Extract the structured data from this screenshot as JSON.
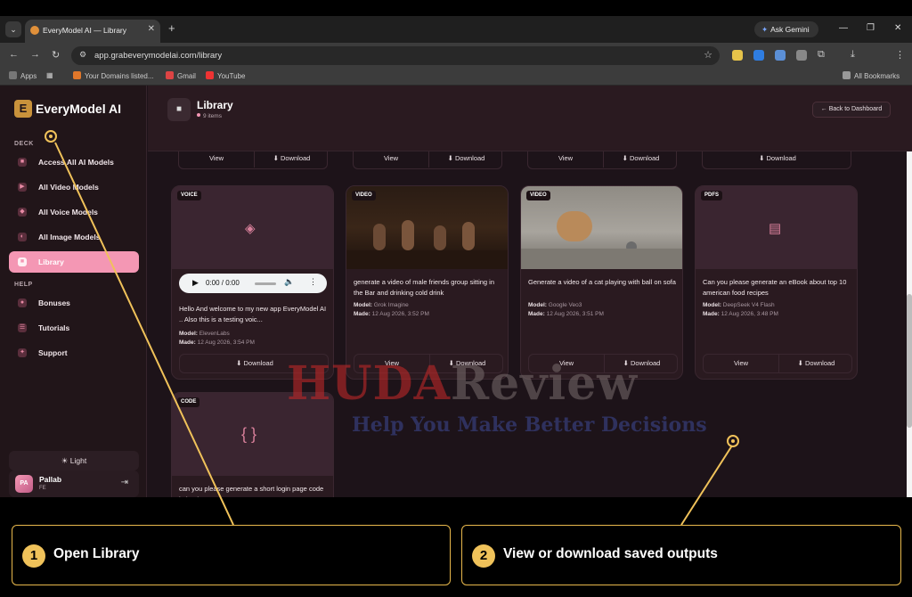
{
  "browser": {
    "tab_title": "EveryModel AI — Library",
    "ask_gemini": "Ask Gemini",
    "url": "app.grabeverymodelai.com/library",
    "bookmarks": [
      "Apps",
      "Your Domains listed...",
      "Gmail",
      "YouTube"
    ],
    "all_bookmarks": "All Bookmarks"
  },
  "sidebar": {
    "logo": "EveryModel AI",
    "logo_mark": "E",
    "section_deck": "DECK",
    "deck_items": [
      {
        "label": "Access All AI Models",
        "icon": "grid-icon"
      },
      {
        "label": "All Video Models",
        "icon": "play-icon"
      },
      {
        "label": "All Voice Models",
        "icon": "voice-icon"
      },
      {
        "label": "All Image Models",
        "icon": "image-icon"
      },
      {
        "label": "Library",
        "icon": "library-icon"
      }
    ],
    "section_help": "HELP",
    "help_items": [
      {
        "label": "Bonuses",
        "icon": "bonus-icon"
      },
      {
        "label": "Tutorials",
        "icon": "tutorial-icon"
      },
      {
        "label": "Support",
        "icon": "support-icon"
      }
    ],
    "light_toggle": "Light",
    "user": {
      "initials": "PA",
      "name": "Pallab",
      "role": "FE"
    }
  },
  "header": {
    "title": "Library",
    "count": "9 items",
    "back_button": "← Back to Dashboard"
  },
  "labels": {
    "view": "View",
    "download": "⬇ Download",
    "model": "Model:",
    "made": "Made:"
  },
  "cards": [
    {
      "type": "VOICE",
      "desc": "Hello And welcome to my new app EveryModel AI .. Also this is a testing voic...",
      "model": "ElevenLabs",
      "made": "12 Aug 2026, 3:54 PM",
      "player_time": "0:00 / 0:00"
    },
    {
      "type": "VIDEO",
      "desc": "generate a video of male friends group sitting in the Bar and drinking cold drink",
      "model": "Grok Imagine",
      "made": "12 Aug 2026, 3:52 PM"
    },
    {
      "type": "VIDEO",
      "desc": "Generate a video of a cat playing with ball on sofa",
      "model": "Google Veo3",
      "made": "12 Aug 2026, 3:51 PM"
    },
    {
      "type": "PDFS",
      "desc": "Can you please generate an eBook about top 10 american food recipes",
      "model": "DeepSeek V4 Flash",
      "made": "12 Aug 2026, 3:48 PM"
    },
    {
      "type": "CODE",
      "desc": "can you please generate a short login page code in html",
      "icon_glyph": "{ }"
    }
  ],
  "watermark": {
    "line1_a": "HUDA",
    "line1_b": "Review",
    "line2": "Help You Make Better Decisions"
  },
  "callouts": [
    {
      "number": "1",
      "text": "Open Library"
    },
    {
      "number": "2",
      "text": "View or download saved outputs"
    }
  ],
  "colors": {
    "accent": "#f497b4",
    "callout": "#f0c25a",
    "bg": "#1d1319"
  }
}
